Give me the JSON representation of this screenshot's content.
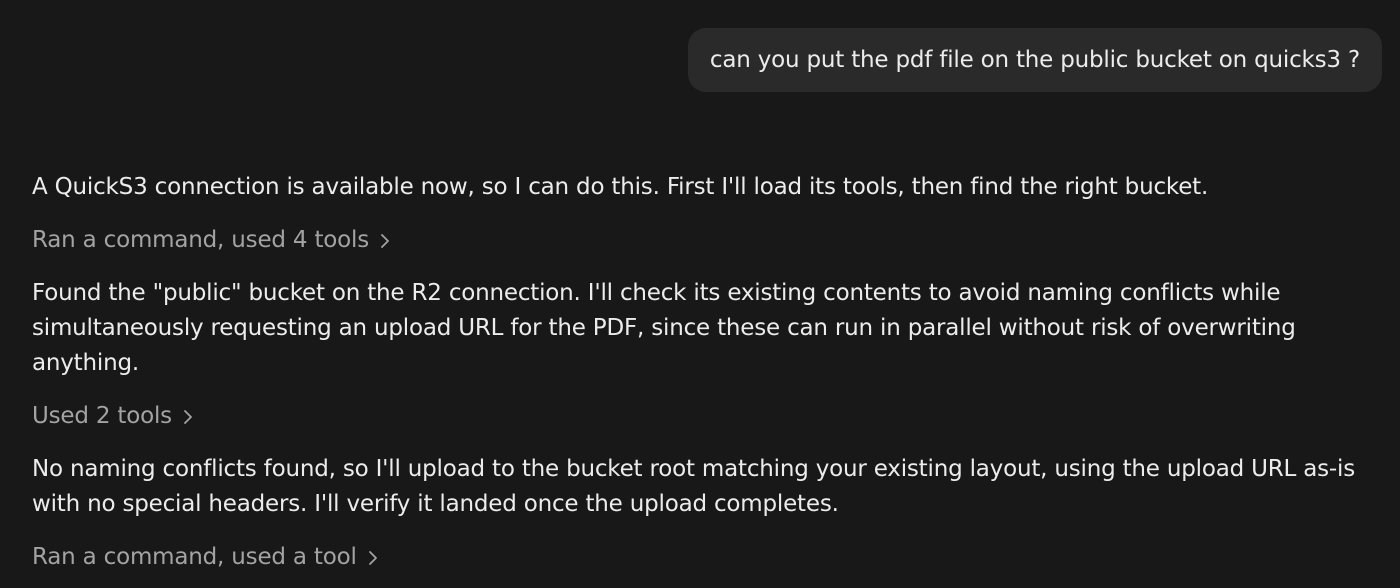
{
  "user_message": {
    "text": "can you put the pdf file on the public bucket on quicks3 ?"
  },
  "assistant": {
    "paragraph_1": "A QuickS3 connection is available now, so I can do this. First I'll load its tools, then find the right bucket.",
    "tools_1": "Ran a command, used 4 tools",
    "paragraph_2": "Found the \"public\" bucket on the R2 connection. I'll check its existing contents to avoid naming conflicts while simultaneously requesting an upload URL for the PDF, since these can run in parallel without risk of overwriting anything.",
    "tools_2": "Used 2 tools",
    "paragraph_3": "No naming conflicts found, so I'll upload to the bucket root matching your existing layout, using the upload URL as-is with no special headers. I'll verify it landed once the upload completes.",
    "tools_3": "Ran a command, used a tool"
  },
  "icons": {
    "expand": "chevron-right-icon"
  },
  "colors": {
    "background": "#181818",
    "bubble": "#2a2a2a",
    "text": "#ececec",
    "muted": "#a3a3a3"
  }
}
